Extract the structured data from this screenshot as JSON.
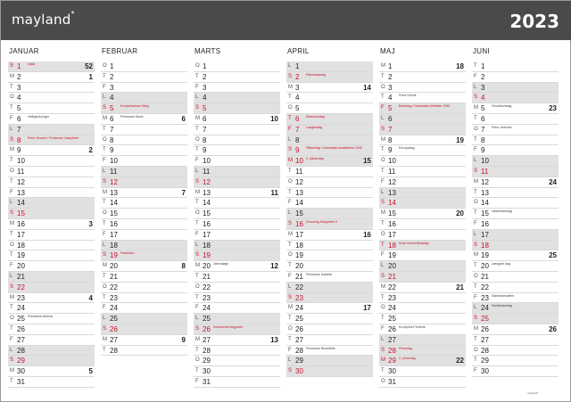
{
  "header": {
    "logo": "mayland",
    "logo_mark": "*",
    "year": "2023"
  },
  "footer": {
    "brand": "mayland*"
  },
  "months": [
    {
      "name": "JANUAR",
      "days": [
        {
          "w": "S",
          "d": "1",
          "note": "Nytår",
          "wk": "52",
          "hol": true,
          "red": true
        },
        {
          "w": "M",
          "d": "2",
          "wk": "1"
        },
        {
          "w": "T",
          "d": "3"
        },
        {
          "w": "O",
          "d": "4"
        },
        {
          "w": "T",
          "d": "5"
        },
        {
          "w": "F",
          "d": "6",
          "note": "Helligtrekonger"
        },
        {
          "w": "L",
          "d": "7",
          "hol": true
        },
        {
          "w": "S",
          "d": "8",
          "note": "Prins Vincent / Prinsesse Josephine",
          "hol": true,
          "red": true
        },
        {
          "w": "M",
          "d": "9",
          "wk": "2"
        },
        {
          "w": "T",
          "d": "10"
        },
        {
          "w": "O",
          "d": "11"
        },
        {
          "w": "T",
          "d": "12"
        },
        {
          "w": "F",
          "d": "13"
        },
        {
          "w": "L",
          "d": "14",
          "hol": true
        },
        {
          "w": "S",
          "d": "15",
          "hol": true,
          "red": true
        },
        {
          "w": "M",
          "d": "16",
          "wk": "3"
        },
        {
          "w": "T",
          "d": "17"
        },
        {
          "w": "O",
          "d": "18"
        },
        {
          "w": "T",
          "d": "19"
        },
        {
          "w": "F",
          "d": "20"
        },
        {
          "w": "L",
          "d": "21",
          "hol": true
        },
        {
          "w": "S",
          "d": "22",
          "hol": true,
          "red": true
        },
        {
          "w": "M",
          "d": "23",
          "wk": "4"
        },
        {
          "w": "T",
          "d": "24"
        },
        {
          "w": "O",
          "d": "25",
          "note": "Prinsesse Athena"
        },
        {
          "w": "T",
          "d": "26"
        },
        {
          "w": "F",
          "d": "27"
        },
        {
          "w": "L",
          "d": "28",
          "hol": true
        },
        {
          "w": "S",
          "d": "29",
          "hol": true,
          "red": true
        },
        {
          "w": "M",
          "d": "30",
          "wk": "5"
        },
        {
          "w": "T",
          "d": "31"
        }
      ]
    },
    {
      "name": "FEBRUAR",
      "days": [
        {
          "w": "O",
          "d": "1"
        },
        {
          "w": "T",
          "d": "2"
        },
        {
          "w": "F",
          "d": "3"
        },
        {
          "w": "L",
          "d": "4",
          "hol": true
        },
        {
          "w": "S",
          "d": "5",
          "note": "Kronprinsesse Mary",
          "hol": true,
          "red": true
        },
        {
          "w": "M",
          "d": "6",
          "note": "Prinsesse Marie",
          "wk": "6"
        },
        {
          "w": "T",
          "d": "7"
        },
        {
          "w": "O",
          "d": "8"
        },
        {
          "w": "T",
          "d": "9"
        },
        {
          "w": "F",
          "d": "10"
        },
        {
          "w": "L",
          "d": "11",
          "hol": true
        },
        {
          "w": "S",
          "d": "12",
          "hol": true,
          "red": true
        },
        {
          "w": "M",
          "d": "13",
          "wk": "7"
        },
        {
          "w": "T",
          "d": "14"
        },
        {
          "w": "O",
          "d": "15"
        },
        {
          "w": "T",
          "d": "16"
        },
        {
          "w": "F",
          "d": "17"
        },
        {
          "w": "L",
          "d": "18",
          "hol": true
        },
        {
          "w": "S",
          "d": "19",
          "note": "Fastelavn",
          "hol": true,
          "red": true
        },
        {
          "w": "M",
          "d": "20",
          "wk": "8"
        },
        {
          "w": "T",
          "d": "21"
        },
        {
          "w": "O",
          "d": "22"
        },
        {
          "w": "T",
          "d": "23"
        },
        {
          "w": "F",
          "d": "24"
        },
        {
          "w": "L",
          "d": "25",
          "hol": true
        },
        {
          "w": "S",
          "d": "26",
          "hol": true,
          "red": true
        },
        {
          "w": "M",
          "d": "27",
          "wk": "9"
        },
        {
          "w": "T",
          "d": "28"
        }
      ]
    },
    {
      "name": "MARTS",
      "days": [
        {
          "w": "O",
          "d": "1"
        },
        {
          "w": "T",
          "d": "2"
        },
        {
          "w": "F",
          "d": "3"
        },
        {
          "w": "L",
          "d": "4",
          "hol": true
        },
        {
          "w": "S",
          "d": "5",
          "hol": true,
          "red": true
        },
        {
          "w": "M",
          "d": "6",
          "wk": "10"
        },
        {
          "w": "T",
          "d": "7"
        },
        {
          "w": "O",
          "d": "8"
        },
        {
          "w": "T",
          "d": "9"
        },
        {
          "w": "F",
          "d": "10"
        },
        {
          "w": "L",
          "d": "11",
          "hol": true
        },
        {
          "w": "S",
          "d": "12",
          "hol": true,
          "red": true
        },
        {
          "w": "M",
          "d": "13",
          "wk": "11"
        },
        {
          "w": "T",
          "d": "14"
        },
        {
          "w": "O",
          "d": "15"
        },
        {
          "w": "T",
          "d": "16"
        },
        {
          "w": "F",
          "d": "17"
        },
        {
          "w": "L",
          "d": "18",
          "hol": true
        },
        {
          "w": "S",
          "d": "19",
          "hol": true,
          "red": true
        },
        {
          "w": "M",
          "d": "20",
          "note": "Jævndøgn",
          "wk": "12"
        },
        {
          "w": "T",
          "d": "21"
        },
        {
          "w": "O",
          "d": "22"
        },
        {
          "w": "T",
          "d": "23"
        },
        {
          "w": "F",
          "d": "24"
        },
        {
          "w": "L",
          "d": "25",
          "hol": true
        },
        {
          "w": "S",
          "d": "26",
          "note": "Sommertid begynder",
          "hol": true,
          "red": true
        },
        {
          "w": "M",
          "d": "27",
          "wk": "13"
        },
        {
          "w": "T",
          "d": "28"
        },
        {
          "w": "O",
          "d": "29"
        },
        {
          "w": "T",
          "d": "30"
        },
        {
          "w": "F",
          "d": "31"
        }
      ]
    },
    {
      "name": "APRIL",
      "days": [
        {
          "w": "L",
          "d": "1",
          "hol": true
        },
        {
          "w": "S",
          "d": "2",
          "note": "Palmesøndag",
          "hol": true,
          "red": true
        },
        {
          "w": "M",
          "d": "3",
          "wk": "14"
        },
        {
          "w": "T",
          "d": "4"
        },
        {
          "w": "O",
          "d": "5"
        },
        {
          "w": "T",
          "d": "6",
          "note": "Skærtorsdag",
          "hol": true,
          "red": true
        },
        {
          "w": "F",
          "d": "7",
          "note": "Langfredag",
          "hol": true,
          "red": true
        },
        {
          "w": "L",
          "d": "8",
          "hol": true
        },
        {
          "w": "S",
          "d": "9",
          "note": "Påskedag / Danmarks besættelse 1940",
          "hol": true,
          "red": true
        },
        {
          "w": "M",
          "d": "10",
          "note": "2. påskedag",
          "wk": "15",
          "hol": true,
          "red": true
        },
        {
          "w": "T",
          "d": "11"
        },
        {
          "w": "O",
          "d": "12"
        },
        {
          "w": "T",
          "d": "13"
        },
        {
          "w": "F",
          "d": "14"
        },
        {
          "w": "L",
          "d": "15",
          "hol": true
        },
        {
          "w": "S",
          "d": "16",
          "note": "Dronning Margrethe II",
          "hol": true,
          "red": true
        },
        {
          "w": "M",
          "d": "17",
          "wk": "16"
        },
        {
          "w": "T",
          "d": "18"
        },
        {
          "w": "O",
          "d": "19"
        },
        {
          "w": "T",
          "d": "20"
        },
        {
          "w": "F",
          "d": "21",
          "note": "Prinsesse Isabella"
        },
        {
          "w": "L",
          "d": "22",
          "hol": true
        },
        {
          "w": "S",
          "d": "23",
          "hol": true,
          "red": true
        },
        {
          "w": "M",
          "d": "24",
          "wk": "17"
        },
        {
          "w": "T",
          "d": "25"
        },
        {
          "w": "O",
          "d": "26"
        },
        {
          "w": "T",
          "d": "27"
        },
        {
          "w": "F",
          "d": "28",
          "note": "Prinsesse Benedikte"
        },
        {
          "w": "L",
          "d": "29",
          "hol": true
        },
        {
          "w": "S",
          "d": "30",
          "hol": true,
          "red": true
        }
      ]
    },
    {
      "name": "MAJ",
      "days": [
        {
          "w": "M",
          "d": "1",
          "wk": "18"
        },
        {
          "w": "T",
          "d": "2"
        },
        {
          "w": "O",
          "d": "3"
        },
        {
          "w": "T",
          "d": "4",
          "note": "Prins Henrik"
        },
        {
          "w": "F",
          "d": "5",
          "note": "Bededag / Danmarks befrielse 1945",
          "hol": true,
          "red": true
        },
        {
          "w": "L",
          "d": "6",
          "hol": true
        },
        {
          "w": "S",
          "d": "7",
          "hol": true,
          "red": true
        },
        {
          "w": "M",
          "d": "8",
          "wk": "19"
        },
        {
          "w": "T",
          "d": "9",
          "note": "Europadag"
        },
        {
          "w": "O",
          "d": "10"
        },
        {
          "w": "T",
          "d": "11"
        },
        {
          "w": "F",
          "d": "12"
        },
        {
          "w": "L",
          "d": "13",
          "hol": true
        },
        {
          "w": "S",
          "d": "14",
          "hol": true,
          "red": true
        },
        {
          "w": "M",
          "d": "15",
          "wk": "20"
        },
        {
          "w": "T",
          "d": "16"
        },
        {
          "w": "O",
          "d": "17"
        },
        {
          "w": "T",
          "d": "18",
          "note": "Kristi himmelfartsdag",
          "hol": true,
          "red": true
        },
        {
          "w": "F",
          "d": "19"
        },
        {
          "w": "L",
          "d": "20",
          "hol": true
        },
        {
          "w": "S",
          "d": "21",
          "hol": true,
          "red": true
        },
        {
          "w": "M",
          "d": "22",
          "wk": "21"
        },
        {
          "w": "T",
          "d": "23"
        },
        {
          "w": "O",
          "d": "24"
        },
        {
          "w": "T",
          "d": "25"
        },
        {
          "w": "F",
          "d": "26",
          "note": "Kronprins Frederik"
        },
        {
          "w": "L",
          "d": "27",
          "hol": true
        },
        {
          "w": "S",
          "d": "28",
          "note": "Pinsedag",
          "hol": true,
          "red": true
        },
        {
          "w": "M",
          "d": "29",
          "note": "2. pinsedag",
          "wk": "22",
          "hol": true,
          "red": true
        },
        {
          "w": "T",
          "d": "30"
        },
        {
          "w": "O",
          "d": "31"
        }
      ]
    },
    {
      "name": "JUNI",
      "days": [
        {
          "w": "T",
          "d": "1"
        },
        {
          "w": "F",
          "d": "2"
        },
        {
          "w": "L",
          "d": "3",
          "hol": true
        },
        {
          "w": "S",
          "d": "4",
          "hol": true,
          "red": true
        },
        {
          "w": "M",
          "d": "5",
          "note": "Grundlovsdag",
          "wk": "23"
        },
        {
          "w": "T",
          "d": "6"
        },
        {
          "w": "O",
          "d": "7",
          "note": "Prins Joachim"
        },
        {
          "w": "T",
          "d": "8"
        },
        {
          "w": "F",
          "d": "9"
        },
        {
          "w": "L",
          "d": "10",
          "hol": true
        },
        {
          "w": "S",
          "d": "11",
          "hol": true,
          "red": true
        },
        {
          "w": "M",
          "d": "12",
          "wk": "24"
        },
        {
          "w": "T",
          "d": "13"
        },
        {
          "w": "O",
          "d": "14"
        },
        {
          "w": "T",
          "d": "15",
          "note": "Valdemarsdag"
        },
        {
          "w": "F",
          "d": "16"
        },
        {
          "w": "L",
          "d": "17",
          "hol": true
        },
        {
          "w": "S",
          "d": "18",
          "hol": true,
          "red": true
        },
        {
          "w": "M",
          "d": "19",
          "wk": "25"
        },
        {
          "w": "T",
          "d": "20",
          "note": "Længste dag"
        },
        {
          "w": "O",
          "d": "21"
        },
        {
          "w": "T",
          "d": "22"
        },
        {
          "w": "F",
          "d": "23",
          "note": "Sankthansaften"
        },
        {
          "w": "L",
          "d": "24",
          "note": "Sankthansdag",
          "hol": true
        },
        {
          "w": "S",
          "d": "25",
          "hol": true,
          "red": true
        },
        {
          "w": "M",
          "d": "26",
          "wk": "26"
        },
        {
          "w": "T",
          "d": "27"
        },
        {
          "w": "O",
          "d": "28"
        },
        {
          "w": "T",
          "d": "29"
        },
        {
          "w": "F",
          "d": "30"
        }
      ]
    }
  ]
}
